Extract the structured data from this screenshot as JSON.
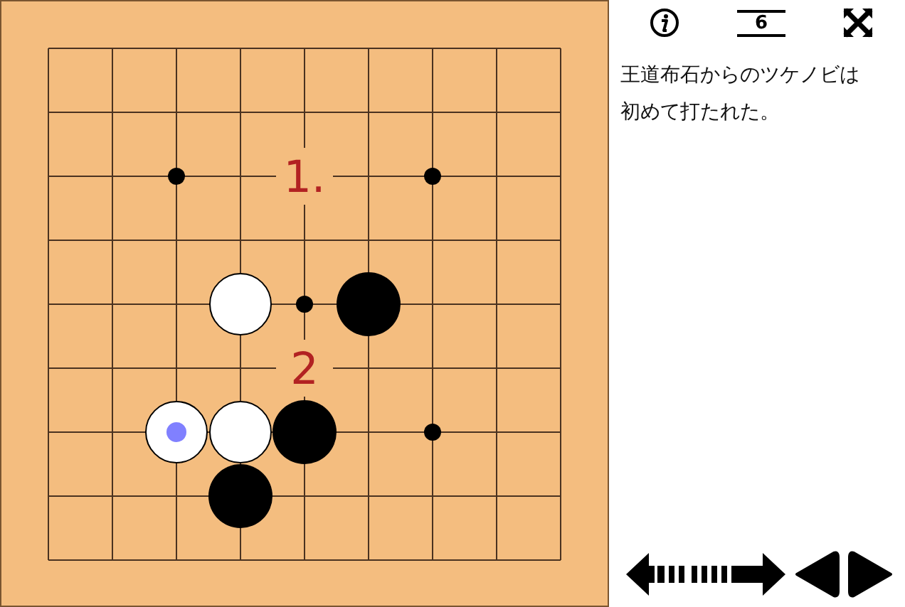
{
  "board": {
    "rows": [
      {
        "points": [
          {
            "kind": "empty"
          },
          {
            "kind": "empty"
          },
          {
            "kind": "empty"
          },
          {
            "kind": "empty"
          },
          {
            "kind": "empty"
          },
          {
            "kind": "empty"
          },
          {
            "kind": "empty"
          },
          {
            "kind": "empty"
          },
          {
            "kind": "empty"
          }
        ]
      },
      {
        "points": [
          {
            "kind": "empty"
          },
          {
            "kind": "empty"
          },
          {
            "kind": "empty"
          },
          {
            "kind": "empty"
          },
          {
            "kind": "empty"
          },
          {
            "kind": "empty"
          },
          {
            "kind": "empty"
          },
          {
            "kind": "empty"
          },
          {
            "kind": "empty"
          }
        ]
      },
      {
        "points": [
          {
            "kind": "empty"
          },
          {
            "kind": "empty"
          },
          {
            "kind": "star"
          },
          {
            "kind": "empty"
          },
          {
            "kind": "label",
            "text": "1."
          },
          {
            "kind": "empty"
          },
          {
            "kind": "star"
          },
          {
            "kind": "empty"
          },
          {
            "kind": "empty"
          }
        ]
      },
      {
        "points": [
          {
            "kind": "empty"
          },
          {
            "kind": "empty"
          },
          {
            "kind": "empty"
          },
          {
            "kind": "empty"
          },
          {
            "kind": "empty"
          },
          {
            "kind": "empty"
          },
          {
            "kind": "empty"
          },
          {
            "kind": "empty"
          },
          {
            "kind": "empty"
          }
        ]
      },
      {
        "points": [
          {
            "kind": "empty"
          },
          {
            "kind": "empty"
          },
          {
            "kind": "empty"
          },
          {
            "kind": "white",
            "marked": false
          },
          {
            "kind": "star"
          },
          {
            "kind": "black",
            "marked": false
          },
          {
            "kind": "empty"
          },
          {
            "kind": "empty"
          },
          {
            "kind": "empty"
          }
        ]
      },
      {
        "points": [
          {
            "kind": "empty"
          },
          {
            "kind": "empty"
          },
          {
            "kind": "empty"
          },
          {
            "kind": "empty"
          },
          {
            "kind": "label",
            "text": "2"
          },
          {
            "kind": "empty"
          },
          {
            "kind": "empty"
          },
          {
            "kind": "empty"
          },
          {
            "kind": "empty"
          }
        ]
      },
      {
        "points": [
          {
            "kind": "empty"
          },
          {
            "kind": "empty"
          },
          {
            "kind": "white",
            "marked": true
          },
          {
            "kind": "white",
            "marked": false
          },
          {
            "kind": "black",
            "marked": false
          },
          {
            "kind": "empty"
          },
          {
            "kind": "star"
          },
          {
            "kind": "empty"
          },
          {
            "kind": "empty"
          }
        ]
      },
      {
        "points": [
          {
            "kind": "empty"
          },
          {
            "kind": "empty"
          },
          {
            "kind": "empty"
          },
          {
            "kind": "black",
            "marked": false
          },
          {
            "kind": "empty"
          },
          {
            "kind": "empty"
          },
          {
            "kind": "empty"
          },
          {
            "kind": "empty"
          },
          {
            "kind": "empty"
          }
        ]
      },
      {
        "points": [
          {
            "kind": "empty"
          },
          {
            "kind": "empty"
          },
          {
            "kind": "empty"
          },
          {
            "kind": "empty"
          },
          {
            "kind": "empty"
          },
          {
            "kind": "empty"
          },
          {
            "kind": "empty"
          },
          {
            "kind": "empty"
          },
          {
            "kind": "empty"
          }
        ]
      }
    ]
  },
  "toolbar": {
    "move_number": "6"
  },
  "comment": "王道布石からのツケノビは初めて打たれた。"
}
